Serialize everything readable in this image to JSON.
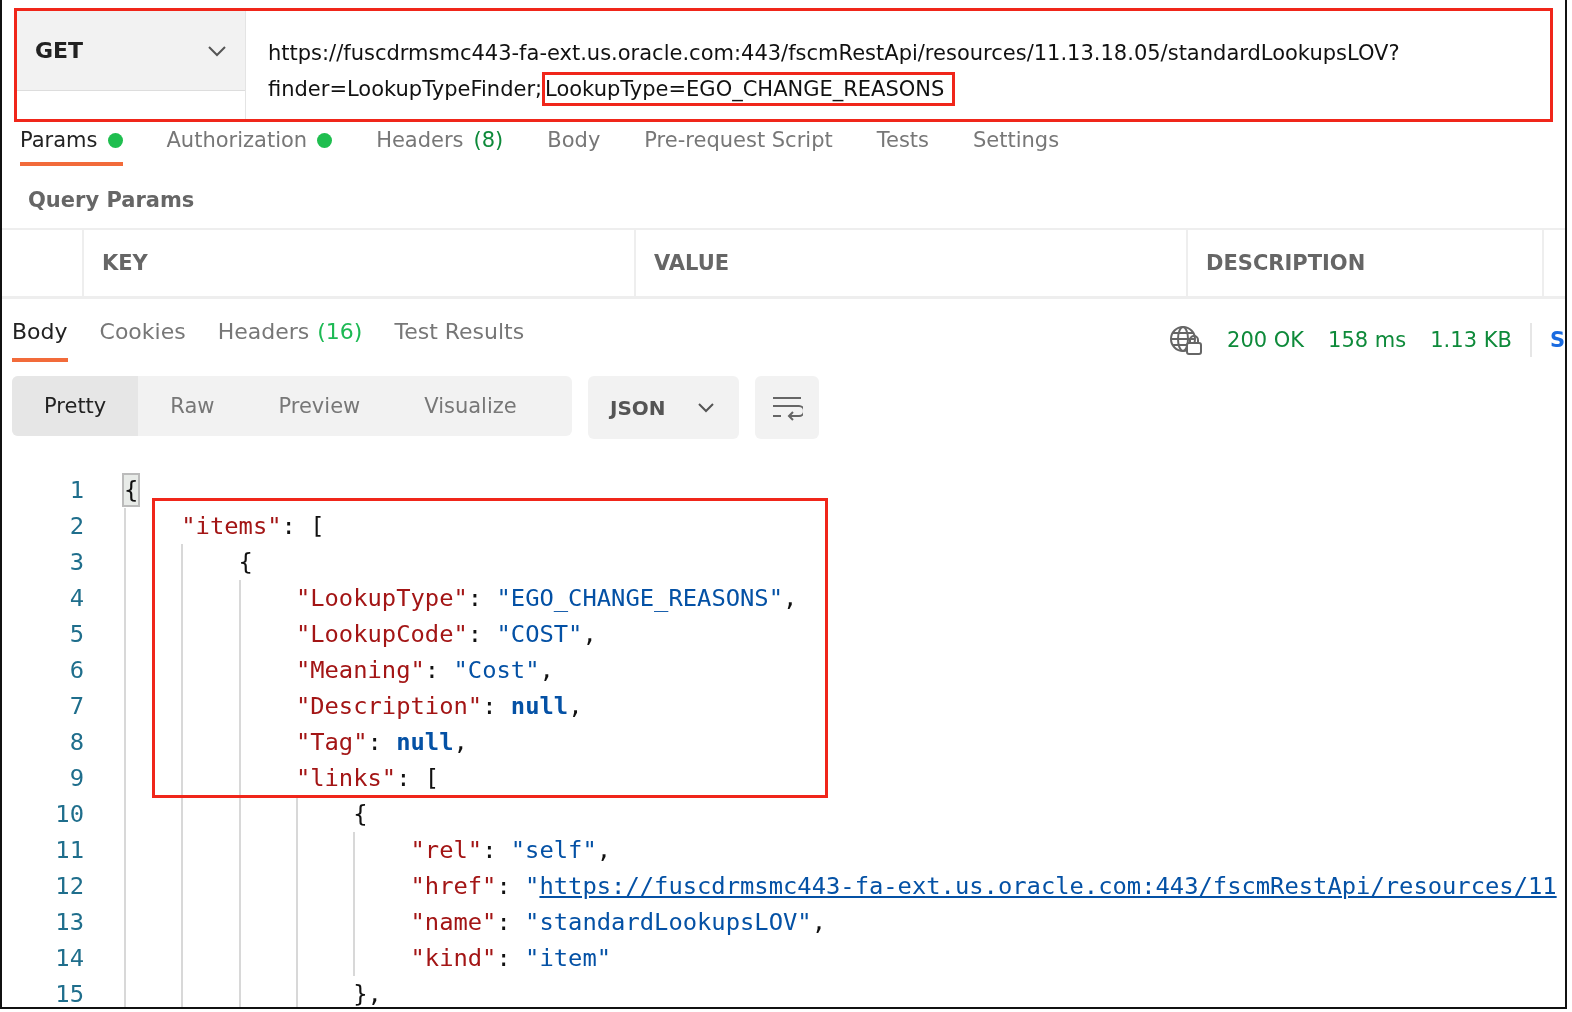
{
  "request": {
    "method": "GET",
    "highlighted": true,
    "url_lines": [
      {
        "parts": [
          {
            "text": "https://fuscdrmsmc443-fa-ext.us.oracle.com:443/fscmRestApi/resources/11.13.18.05/standardLookupsLOV?",
            "highlighted": false
          }
        ]
      },
      {
        "parts": [
          {
            "text": "finder=LookupTypeFinder;",
            "highlighted": false
          },
          {
            "text": "LookupType=EGO_CHANGE_REASONS",
            "highlighted": true
          }
        ]
      }
    ]
  },
  "request_tabs": [
    {
      "label": "Params",
      "selected": true,
      "dot": true
    },
    {
      "label": "Authorization",
      "selected": false,
      "dot": true
    },
    {
      "label": "Headers",
      "count": "(8)",
      "selected": false,
      "dot": false
    },
    {
      "label": "Body",
      "selected": false,
      "dot": false
    },
    {
      "label": "Pre-request Script",
      "selected": false,
      "dot": false
    },
    {
      "label": "Tests",
      "selected": false,
      "dot": false
    },
    {
      "label": "Settings",
      "selected": false,
      "dot": false
    }
  ],
  "query_params": {
    "title": "Query Params",
    "columns": [
      "KEY",
      "VALUE",
      "DESCRIPTION"
    ]
  },
  "response_tabs": [
    {
      "label": "Body",
      "selected": true
    },
    {
      "label": "Cookies",
      "selected": false
    },
    {
      "label": "Headers",
      "count": "(16)",
      "selected": false
    },
    {
      "label": "Test Results",
      "selected": false
    }
  ],
  "status": {
    "code": "200 OK",
    "time": "158 ms",
    "size": "1.13 KB",
    "save": "S"
  },
  "view_modes": [
    {
      "label": "Pretty",
      "selected": true
    },
    {
      "label": "Raw",
      "selected": false
    },
    {
      "label": "Preview",
      "selected": false
    },
    {
      "label": "Visualize",
      "selected": false
    }
  ],
  "format": "JSON",
  "code": [
    {
      "n": "1",
      "boxed": false,
      "tokens": [
        {
          "kind": "bracket",
          "text": "{"
        }
      ],
      "children": [
        {
          "n": "2",
          "boxed": true,
          "tokens": [
            {
              "kind": "key",
              "text": "\"items\""
            },
            {
              "kind": "punct",
              "text": ": ["
            }
          ],
          "children": [
            {
              "n": "3",
              "boxed": true,
              "tokens": [
                {
                  "kind": "punct",
                  "text": "{"
                }
              ],
              "children": [
                {
                  "n": "4",
                  "boxed": true,
                  "tokens": [
                    {
                      "kind": "key",
                      "text": "\"LookupType\""
                    },
                    {
                      "kind": "punct",
                      "text": ": "
                    },
                    {
                      "kind": "string",
                      "text": "\"EGO_CHANGE_REASONS\""
                    },
                    {
                      "kind": "punct",
                      "text": ","
                    }
                  ]
                },
                {
                  "n": "5",
                  "boxed": true,
                  "tokens": [
                    {
                      "kind": "key",
                      "text": "\"LookupCode\""
                    },
                    {
                      "kind": "punct",
                      "text": ": "
                    },
                    {
                      "kind": "string",
                      "text": "\"COST\""
                    },
                    {
                      "kind": "punct",
                      "text": ","
                    }
                  ]
                },
                {
                  "n": "6",
                  "boxed": true,
                  "tokens": [
                    {
                      "kind": "key",
                      "text": "\"Meaning\""
                    },
                    {
                      "kind": "punct",
                      "text": ": "
                    },
                    {
                      "kind": "string",
                      "text": "\"Cost\""
                    },
                    {
                      "kind": "punct",
                      "text": ","
                    }
                  ]
                },
                {
                  "n": "7",
                  "boxed": true,
                  "tokens": [
                    {
                      "kind": "key",
                      "text": "\"Description\""
                    },
                    {
                      "kind": "punct",
                      "text": ": "
                    },
                    {
                      "kind": "null",
                      "text": "null"
                    },
                    {
                      "kind": "punct",
                      "text": ","
                    }
                  ]
                },
                {
                  "n": "8",
                  "boxed": true,
                  "tokens": [
                    {
                      "kind": "key",
                      "text": "\"Tag\""
                    },
                    {
                      "kind": "punct",
                      "text": ": "
                    },
                    {
                      "kind": "null",
                      "text": "null"
                    },
                    {
                      "kind": "punct",
                      "text": ","
                    }
                  ]
                },
                {
                  "n": "9",
                  "boxed": true,
                  "tokens": [
                    {
                      "kind": "key",
                      "text": "\"links\""
                    },
                    {
                      "kind": "punct",
                      "text": ": ["
                    }
                  ],
                  "children": [
                    {
                      "n": "10",
                      "boxed": false,
                      "tokens": [
                        {
                          "kind": "punct",
                          "text": "{"
                        }
                      ],
                      "children": [
                        {
                          "n": "11",
                          "boxed": false,
                          "tokens": [
                            {
                              "kind": "key",
                              "text": "\"rel\""
                            },
                            {
                              "kind": "punct",
                              "text": ": "
                            },
                            {
                              "kind": "string",
                              "text": "\"self\""
                            },
                            {
                              "kind": "punct",
                              "text": ","
                            }
                          ]
                        },
                        {
                          "n": "12",
                          "boxed": false,
                          "tokens": [
                            {
                              "kind": "key",
                              "text": "\"href\""
                            },
                            {
                              "kind": "punct",
                              "text": ": "
                            },
                            {
                              "kind": "string",
                              "text": "\""
                            },
                            {
                              "kind": "link",
                              "text": "https://fuscdrmsmc443-fa-ext.us.oracle.com:443/fscmRestApi/resources/11"
                            }
                          ]
                        },
                        {
                          "n": "13",
                          "boxed": false,
                          "tokens": [
                            {
                              "kind": "key",
                              "text": "\"name\""
                            },
                            {
                              "kind": "punct",
                              "text": ": "
                            },
                            {
                              "kind": "string",
                              "text": "\"standardLookupsLOV\""
                            },
                            {
                              "kind": "punct",
                              "text": ","
                            }
                          ]
                        },
                        {
                          "n": "14",
                          "boxed": false,
                          "tokens": [
                            {
                              "kind": "key",
                              "text": "\"kind\""
                            },
                            {
                              "kind": "punct",
                              "text": ": "
                            },
                            {
                              "kind": "string",
                              "text": "\"item\""
                            }
                          ]
                        }
                      ]
                    },
                    {
                      "n": "15",
                      "boxed": false,
                      "tokens": [
                        {
                          "kind": "punct",
                          "text": "},"
                        }
                      ]
                    }
                  ]
                }
              ]
            }
          ]
        }
      ]
    }
  ]
}
